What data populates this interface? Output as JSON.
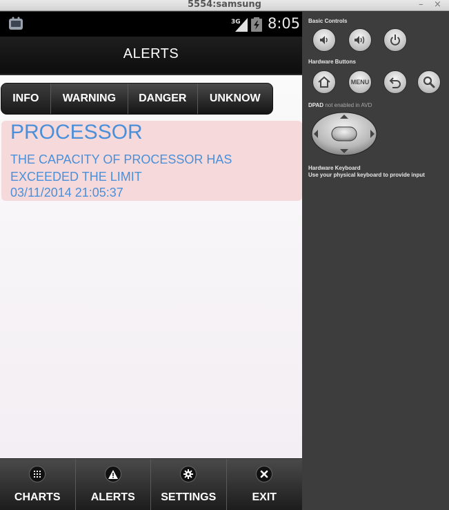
{
  "window": {
    "title": "5554:samsung",
    "minimize_glyph": "–",
    "close_glyph": "×"
  },
  "statusbar": {
    "time": "8:05",
    "network": "3G",
    "icons": [
      "android-app-icon",
      "signal-icon",
      "battery-icon"
    ]
  },
  "actionbar": {
    "title": "ALERTS"
  },
  "filters": {
    "items": [
      {
        "label": "INFO",
        "selected": true
      },
      {
        "label": "WARNING",
        "selected": false
      },
      {
        "label": "DANGER",
        "selected": false
      },
      {
        "label": "UNKNOW",
        "selected": false
      }
    ]
  },
  "alerts": [
    {
      "title": "PROCESSOR",
      "message": "THE CAPACITY OF PROCESSOR HAS EXCEEDED THE LIMIT",
      "timestamp": "03/11/2014 21:05:37",
      "background": "#f6dadb",
      "text_color": "#4a8fd9"
    }
  ],
  "tabbar": {
    "items": [
      {
        "label": "CHARTS",
        "icon": "grid-icon"
      },
      {
        "label": "ALERTS",
        "icon": "warning-icon"
      },
      {
        "label": "SETTINGS",
        "icon": "gear-icon"
      },
      {
        "label": "EXIT",
        "icon": "close-icon"
      }
    ]
  },
  "panel": {
    "basic_controls_label": "Basic Controls",
    "hardware_buttons_label": "Hardware Buttons",
    "dpad_label": "DPAD",
    "dpad_note": "not enabled in AVD",
    "keyboard_label": "Hardware Keyboard",
    "keyboard_note": "Use your physical keyboard to provide input",
    "menu_label": "MENU",
    "icons": [
      "volume-down-icon",
      "volume-up-icon",
      "power-icon",
      "home-icon",
      "menu-button",
      "back-icon",
      "search-icon",
      "dpad"
    ]
  }
}
